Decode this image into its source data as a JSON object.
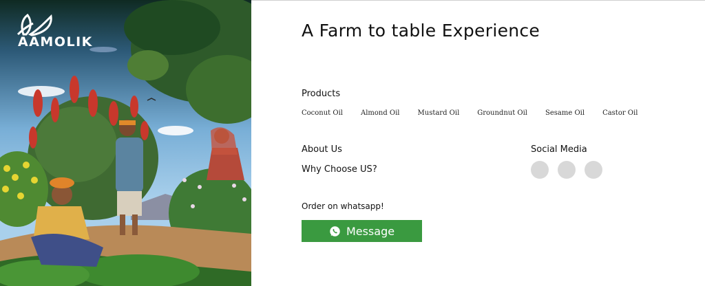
{
  "brand": {
    "name": "AAMOLIK"
  },
  "hero": {
    "alt_subject": "farm-illustration"
  },
  "title": "A Farm to table Experience",
  "products": {
    "heading": "Products",
    "items": [
      "Coconut Oil",
      "Almond Oil",
      "Mustard Oil",
      "Groundnut Oil",
      "Sesame Oil",
      "Castor Oil"
    ]
  },
  "links": {
    "about": "About Us",
    "why": "Why Choose US?"
  },
  "social": {
    "heading": "Social Media",
    "icons": [
      "social-icon-1",
      "social-icon-2",
      "social-icon-3"
    ]
  },
  "order": {
    "label": "Order on whatsapp!",
    "button_label": "Message"
  },
  "colors": {
    "accent": "#3a9a40",
    "icon_placeholder": "#d8d8d8",
    "text": "#111111"
  }
}
